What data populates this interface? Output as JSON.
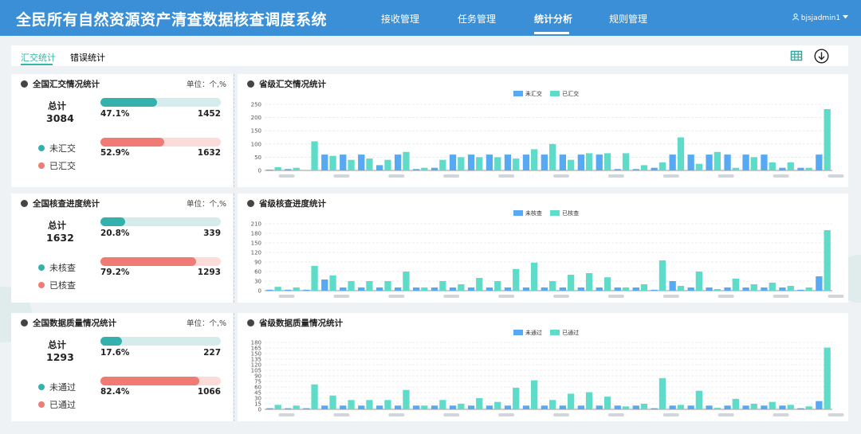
{
  "app": {
    "title": "全民所有自然资源资产清查数据核查调度系统",
    "user": "bjsjadmin1"
  },
  "nav": [
    "接收管理",
    "任务管理",
    "统计分析",
    "规则管理"
  ],
  "tabs": [
    "汇交统计",
    "错误统计"
  ],
  "unit_label": "单位：个,%",
  "total_label": "总计",
  "colors": {
    "header": "#3a8fd6",
    "teal": "#35b1ad",
    "teal_track": "#d6ecec",
    "red": "#f07a74",
    "red_track": "#fbdcd9",
    "bar_blue": "#58a9f3",
    "bar_green": "#5fdcc9"
  },
  "sections": [
    {
      "left": {
        "title": "全国汇交情况统计",
        "total": "3084",
        "bar1": {
          "pct": "47.1%",
          "count": "1452",
          "fraction": 0.471
        },
        "bar2": {
          "pct": "52.9%",
          "count": "1632",
          "fraction": 0.529
        },
        "legend1": "未汇交",
        "legend2": "已汇交"
      },
      "right": {
        "title": "省级汇交情况统计",
        "series": [
          "未汇交",
          "已汇交"
        ]
      }
    },
    {
      "left": {
        "title": "全国核查进度统计",
        "total": "1632",
        "bar1": {
          "pct": "20.8%",
          "count": "339",
          "fraction": 0.208
        },
        "bar2": {
          "pct": "79.2%",
          "count": "1293",
          "fraction": 0.792
        },
        "legend1": "未核查",
        "legend2": "已核查"
      },
      "right": {
        "title": "省级核查进度统计",
        "series": [
          "未核查",
          "已核查"
        ]
      }
    },
    {
      "left": {
        "title": "全国数据质量情况统计",
        "total": "1293",
        "bar1": {
          "pct": "17.6%",
          "count": "227",
          "fraction": 0.176
        },
        "bar2": {
          "pct": "82.4%",
          "count": "1066",
          "fraction": 0.824
        },
        "legend1": "未通过",
        "legend2": "已通过"
      },
      "right": {
        "title": "省级数据质量情况统计",
        "series": [
          "未通过",
          "已通过"
        ]
      }
    }
  ],
  "chart_data": [
    {
      "type": "bar",
      "yticks": [
        0,
        50,
        100,
        150,
        200,
        250
      ],
      "ylim": [
        0,
        250
      ],
      "series": [
        {
          "name": "未汇交",
          "values": [
            3,
            5,
            0,
            60,
            60,
            60,
            20,
            60,
            5,
            10,
            60,
            60,
            60,
            60,
            60,
            60,
            60,
            60,
            60,
            5,
            5,
            10,
            60,
            60,
            60,
            60,
            60,
            60,
            10,
            10,
            60
          ]
        },
        {
          "name": "已汇交",
          "values": [
            12,
            10,
            110,
            55,
            40,
            45,
            40,
            70,
            10,
            40,
            50,
            50,
            50,
            45,
            80,
            100,
            40,
            65,
            65,
            65,
            20,
            30,
            125,
            25,
            70,
            10,
            50,
            30,
            30,
            10,
            232
          ]
        }
      ]
    },
    {
      "type": "bar",
      "yticks": [
        0,
        30,
        60,
        90,
        120,
        150,
        180,
        210
      ],
      "ylim": [
        0,
        210
      ],
      "series": [
        {
          "name": "未核查",
          "values": [
            3,
            3,
            3,
            35,
            10,
            10,
            10,
            10,
            10,
            10,
            10,
            10,
            10,
            10,
            10,
            10,
            10,
            10,
            10,
            10,
            10,
            3,
            30,
            10,
            10,
            10,
            10,
            10,
            10,
            3,
            45
          ]
        },
        {
          "name": "已核查",
          "values": [
            12,
            10,
            78,
            48,
            30,
            30,
            30,
            60,
            10,
            30,
            20,
            40,
            30,
            68,
            88,
            30,
            50,
            55,
            42,
            10,
            20,
            95,
            15,
            60,
            5,
            38,
            20,
            25,
            15,
            10,
            190
          ]
        }
      ]
    },
    {
      "type": "bar",
      "yticks": [
        0,
        15,
        30,
        45,
        60,
        75,
        90,
        105,
        120,
        135,
        150,
        165,
        180
      ],
      "ylim": [
        0,
        180
      ],
      "series": [
        {
          "name": "未通过",
          "values": [
            3,
            3,
            3,
            10,
            10,
            10,
            10,
            10,
            10,
            10,
            10,
            10,
            10,
            10,
            10,
            10,
            10,
            10,
            10,
            10,
            10,
            3,
            10,
            10,
            10,
            10,
            10,
            10,
            10,
            3,
            22
          ]
        },
        {
          "name": "已通过",
          "values": [
            12,
            10,
            67,
            37,
            25,
            25,
            25,
            52,
            10,
            25,
            15,
            30,
            20,
            58,
            78,
            25,
            42,
            46,
            34,
            8,
            15,
            84,
            12,
            50,
            4,
            28,
            15,
            20,
            12,
            8,
            166
          ]
        }
      ]
    }
  ]
}
